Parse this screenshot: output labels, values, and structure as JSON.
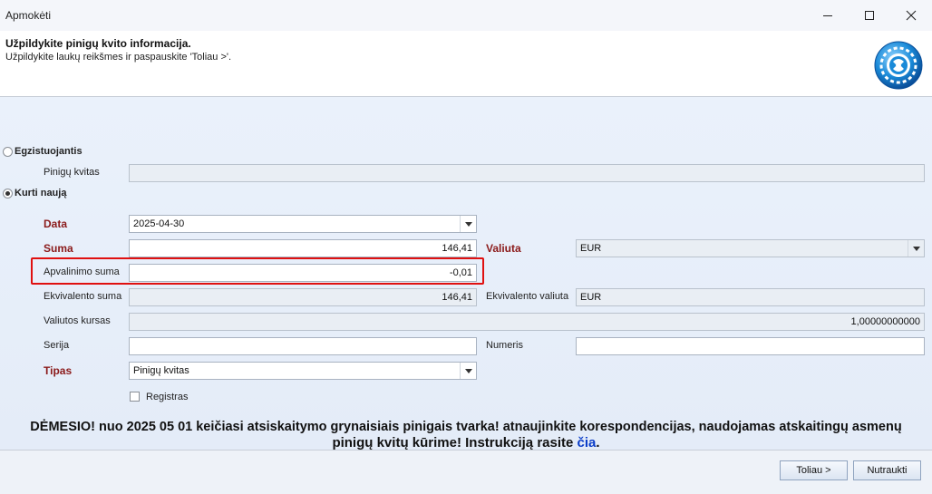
{
  "window": {
    "title": "Apmokėti"
  },
  "header": {
    "title": "Užpildykite pinigų kvito informacija.",
    "subtitle": "Užpildykite laukų reikšmes ir paspauskite 'Toliau >'."
  },
  "options": {
    "existing_label": "Egzistuojantis",
    "existing_selected": false,
    "create_label": "Kurti naują",
    "create_selected": true
  },
  "existing": {
    "receipt_label": "Pinigų kvitas",
    "receipt_value": ""
  },
  "form": {
    "date_label": "Data",
    "date_value": "2025-04-30",
    "sum_label": "Suma",
    "sum_value": "146,41",
    "currency_label": "Valiuta",
    "currency_value": "EUR",
    "rounding_label": "Apvalinimo suma",
    "rounding_value": "-0,01",
    "equiv_sum_label": "Ekvivalento suma",
    "equiv_sum_value": "146,41",
    "equiv_currency_label": "Ekvivalento valiuta",
    "equiv_currency_value": "EUR",
    "rate_label": "Valiutos kursas",
    "rate_value": "1,00000000000",
    "series_label": "Serija",
    "series_value": "",
    "number_label": "Numeris",
    "number_value": "",
    "type_label": "Tipas",
    "type_value": "Pinigų kvitas",
    "register_label": "Registras",
    "register_checked": false
  },
  "notice": {
    "line1": "DĖMESIO! nuo 2025 05 01 keičiasi atsiskaitymo grynaisiais pinigais tvarka! atnaujinkite korespondencijas, naudojamas atskaitingų asmenų",
    "line2_text": "pinigų kvitų kūrime! Instrukciją rasite ",
    "link": "čia",
    "line2_end": "."
  },
  "buttons": {
    "next": "Toliau >",
    "cancel": "Nutraukti"
  },
  "colors": {
    "required_label": "#8b1a1a",
    "highlight": "#e01010",
    "link": "#0a3cc8"
  },
  "icons": {
    "minimize": "minimize-icon",
    "maximize": "maximize-icon",
    "close": "close-icon",
    "logo": "gear-logo-icon",
    "dropdown": "chevron-down-icon"
  }
}
